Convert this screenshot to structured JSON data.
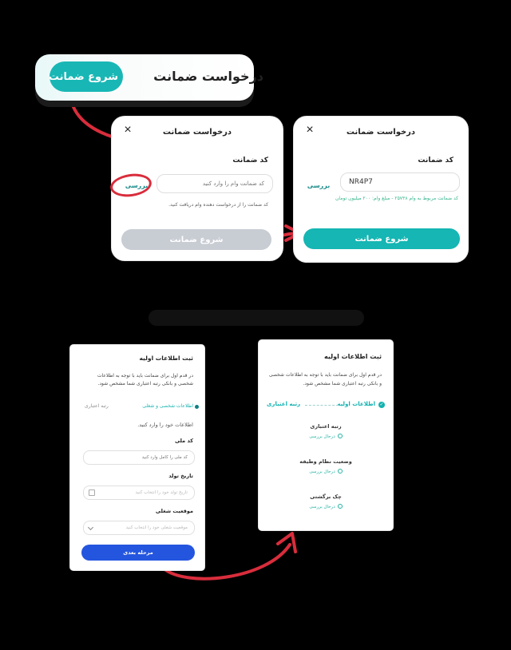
{
  "top_pill": {
    "title": "درخواست ضمانت",
    "button": "شروع ضمانت"
  },
  "left_modal": {
    "title": "درخواست ضمانت",
    "close": "×",
    "field_label": "کد ضمانت",
    "input_placeholder": "کد ضمانت وام را وارد کنید",
    "check_label": "بررسی",
    "help_text": "کد ضمانت را از درخواست دهنده وام دریافت کنید.",
    "button": "شروع ضمانت"
  },
  "right_modal": {
    "title": "درخواست ضمانت",
    "close": "×",
    "field_label": "کد ضمانت",
    "input_value": "NR4P7",
    "check_label": "بررسی",
    "success_text": "کد ضمانت مربوط به وام ۲۵۷۳۸ - مبلغ وام: ۲۰۰ میلیون تومان",
    "button": "شروع ضمانت"
  },
  "form_card": {
    "title": "ثبت اطلاعات اولیه",
    "description": "در قدم اول برای ضمانت باید با توجه به اطلاعات شخصی و بانکی رتبه اعتباری شما مشخص شود.",
    "step_active": "اطلاعات شخصی و شغلی",
    "step_pending": "رتبه اعتباری",
    "prompt": "اطلاعات خود را وارد کنید.",
    "fields": [
      {
        "label": "کد ملی",
        "placeholder": "کد ملی را کامل وارد کنید"
      },
      {
        "label": "تاریخ تولد",
        "placeholder": "تاریخ تولد خود را انتخاب کنید"
      },
      {
        "label": "موقعیت شغلی",
        "placeholder": "موقعیت شغلی خود را انتخاب کنید"
      }
    ],
    "button": "مرحله بعدی"
  },
  "status_card": {
    "title": "ثبت اطلاعات اولیه",
    "description": "در قدم اول برای ضمانت باید با توجه به اطلاعات شخصی و بانکی رتبه اعتباری شما مشخص شود.",
    "step_active": "اطلاعات اولیه",
    "step_pending": "رتبه اعتباری",
    "items": [
      {
        "name": "رتبه اعتباری",
        "status": "درحال بررسی"
      },
      {
        "name": "وضعیت نظام وظیفه",
        "status": "درحال بررسی"
      },
      {
        "name": "چک برگشتی",
        "status": "درحال بررسی"
      }
    ]
  },
  "colors": {
    "teal": "#18b7b5",
    "blue": "#2455df",
    "red_arrow": "#d92d3c",
    "disabled": "#c8ccd3"
  },
  "icons": [
    "close-icon",
    "calendar-icon",
    "chevron-down-icon",
    "check-icon",
    "gear-icon",
    "arrow-icon"
  ]
}
